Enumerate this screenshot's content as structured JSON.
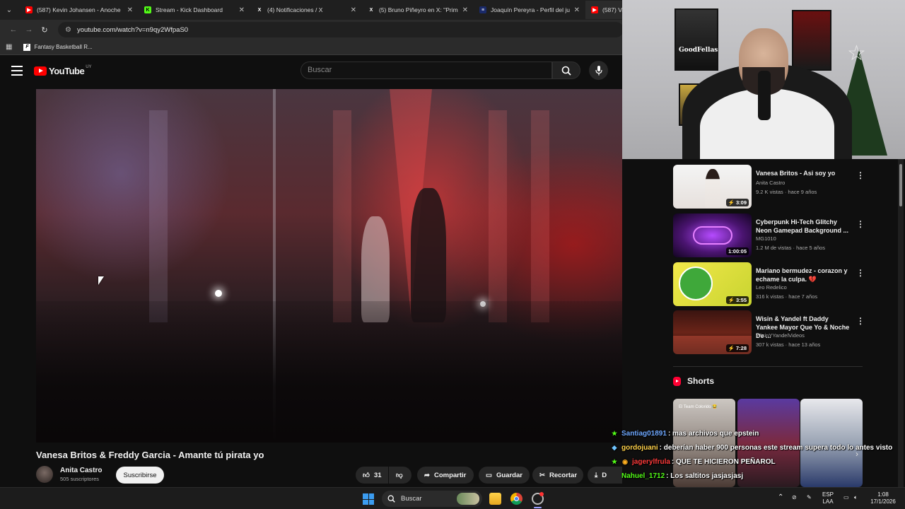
{
  "browser": {
    "tabs": [
      {
        "title": "(587) Kevin Johansen - Anoche",
        "favicon_color": "#ff0000",
        "favicon": "▶"
      },
      {
        "title": "Stream - Kick Dashboard",
        "favicon_color": "#53fc18",
        "favicon": "K"
      },
      {
        "title": "(4) Notificaciones / X",
        "favicon_color": "#000000",
        "favicon": "X"
      },
      {
        "title": "(5) Bruno Piñeyro en X: \"Primer",
        "favicon_color": "#000000",
        "favicon": "X"
      },
      {
        "title": "Joaquín Pereyra - Perfil del jug",
        "favicon_color": "#1a2a6a",
        "favicon": "≡"
      },
      {
        "title": "(587) Vanes",
        "favicon_color": "#ff0000",
        "favicon": "▶"
      }
    ],
    "url": "youtube.com/watch?v=n9qy2WfpaS0",
    "bookmark": {
      "label": "Fantasy Basketball R...",
      "icon": "F"
    }
  },
  "youtube": {
    "logo_text": "YouTube",
    "country_code": "UY",
    "search_placeholder": "Buscar",
    "video": {
      "title": "Vanesa Britos & Freddy Garcia - Amante tú pirata yo",
      "channel": "Anita Castro",
      "subscribers": "505 suscriptores",
      "subscribe_label": "Suscribirse",
      "likes": "31",
      "share_label": "Compartir",
      "save_label": "Guardar",
      "clip_label": "Recortar",
      "download_label": "D"
    },
    "recommendations": [
      {
        "title": "Vanesa Britos - Asi soy yo",
        "channel": "Anita Castro",
        "meta": "9.2 K vistas · hace 9 años",
        "duration": "3:09",
        "short_icon": true
      },
      {
        "title": "Cyberpunk Hi-Tech Glitchy Neon Gamepad Background ...",
        "channel": "MG1010",
        "meta": "1.2 M de vistas · hace 5 años",
        "duration": "1:00:05"
      },
      {
        "title": "Mariano bermudez - corazon y echame la culpa. 💔",
        "channel": "Leo Redelico",
        "meta": "316 k vistas · hace 7 años",
        "duration": "3:55",
        "short_icon": true
      },
      {
        "title": "Wisin & Yandel ft Daddy Yankee Mayor Que Yo & Noche De ...",
        "channel": "WisinYYandelVideos",
        "meta": "307 k vistas · hace 13 años",
        "duration": "7:28",
        "short_icon": true
      }
    ],
    "shorts_label": "Shorts",
    "short_overlay_text": "El Team Colorido 😂"
  },
  "chat": [
    {
      "badge": "★",
      "badge_color": "#53fc18",
      "user": "Santiag01891",
      "user_color": "#6fa8ff",
      "message": ": mas archivos que epstein"
    },
    {
      "badge": "◆",
      "badge_color": "#6fc4ff",
      "user": "gordojuani",
      "user_color": "#ffd24a",
      "message": ": deberían haber 900 personas este stream supera todo lo antes visto"
    },
    {
      "badge": "★",
      "badge_color": "#53fc18",
      "badge2": "◉",
      "user": "jagerylfrula",
      "user_color": "#ff3b3b",
      "message": ": QUE TE HICIERON PEÑAROL"
    },
    {
      "badge": "",
      "badge_color": "#53fc18",
      "user": "Nahuel_1712",
      "user_color": "#53fc18",
      "message": ": Los saltitos jasjasjasj"
    }
  ],
  "taskbar": {
    "search_label": "Buscar",
    "language": "ESP",
    "language_sub": "LAA",
    "time": "1:08",
    "date": "17/1/2026"
  }
}
